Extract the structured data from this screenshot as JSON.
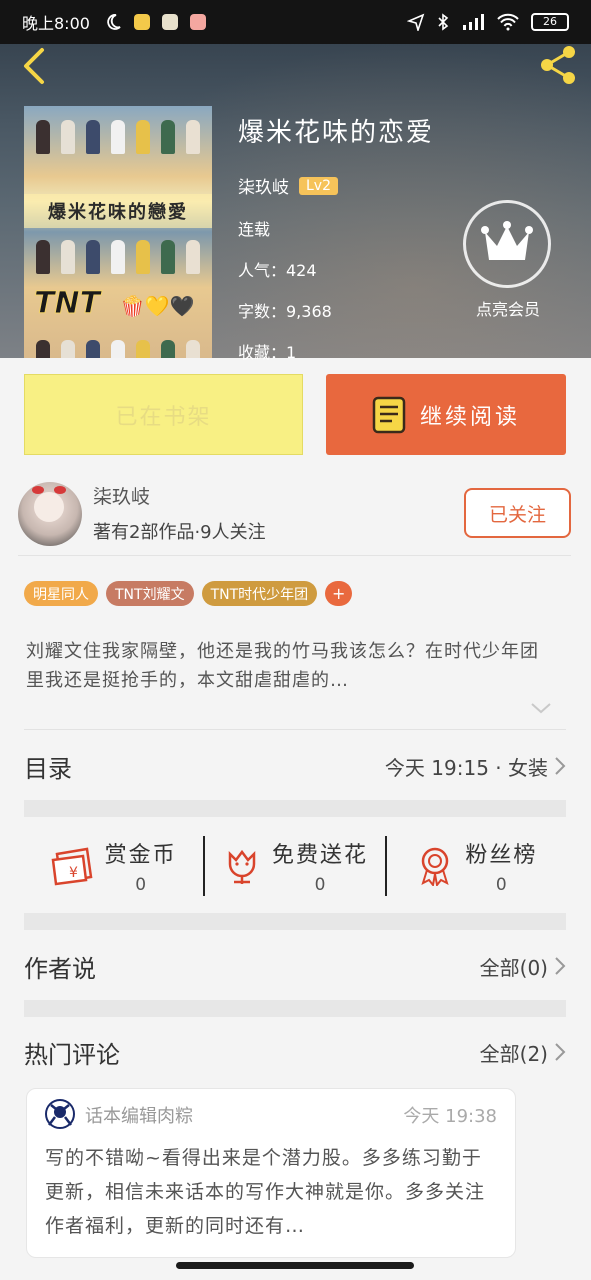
{
  "status_bar": {
    "time": "晚上8:00",
    "battery": "26"
  },
  "book": {
    "title": "爆米花味的恋爱",
    "author": "柒玖岐",
    "level": "Lv2",
    "status": "连载",
    "popularity": "人气：424",
    "word_count": "字数：9,368",
    "favorites": "收藏：1",
    "cover": {
      "title_line": "爆米花味的戀愛",
      "brand": "TNT",
      "emoji": "🍿💛🖤"
    }
  },
  "vip": {
    "label": "点亮会员"
  },
  "actions": {
    "shelf_label": "已在书架",
    "read_label": "继续阅读"
  },
  "author_card": {
    "name": "柒玖岐",
    "works": "著有2部作品·9人关注",
    "follow_label": "已关注"
  },
  "tags": [
    {
      "label": "明星同人",
      "color": "#f1a94a"
    },
    {
      "label": "TNT刘耀文",
      "color": "#c77b63"
    },
    {
      "label": "TNT时代少年团",
      "color": "#cf9b3f"
    }
  ],
  "tag_more": "+",
  "synopsis": "刘耀文住我家隔壁，他还是我的竹马我该怎么？在时代少年团里我还是挺抢手的，本文甜虐甜虐的…",
  "catalog": {
    "label": "目录",
    "value": "今天 19:15 · 女装"
  },
  "gifts": [
    {
      "title": "赏金币",
      "count": "0",
      "icon": "red-envelope-icon"
    },
    {
      "title": "免费送花",
      "count": "0",
      "icon": "flower-icon"
    },
    {
      "title": "粉丝榜",
      "count": "0",
      "icon": "medal-icon"
    }
  ],
  "author_says": {
    "label": "作者说",
    "value": "全部(0)"
  },
  "hot_comments": {
    "label": "热门评论",
    "value": "全部(2)"
  },
  "comment": {
    "name": "话本编辑肉粽",
    "time": "今天 19:38",
    "body": "写的不错呦~看得出来是个潜力股。多多练习勤于更新，相信未来话本的写作大神就是你。多多关注作者福利，更新的同时还有…"
  },
  "colors": {
    "accent": "#e8683e",
    "shelf": "#f8f084",
    "level": "#f6c35a"
  }
}
